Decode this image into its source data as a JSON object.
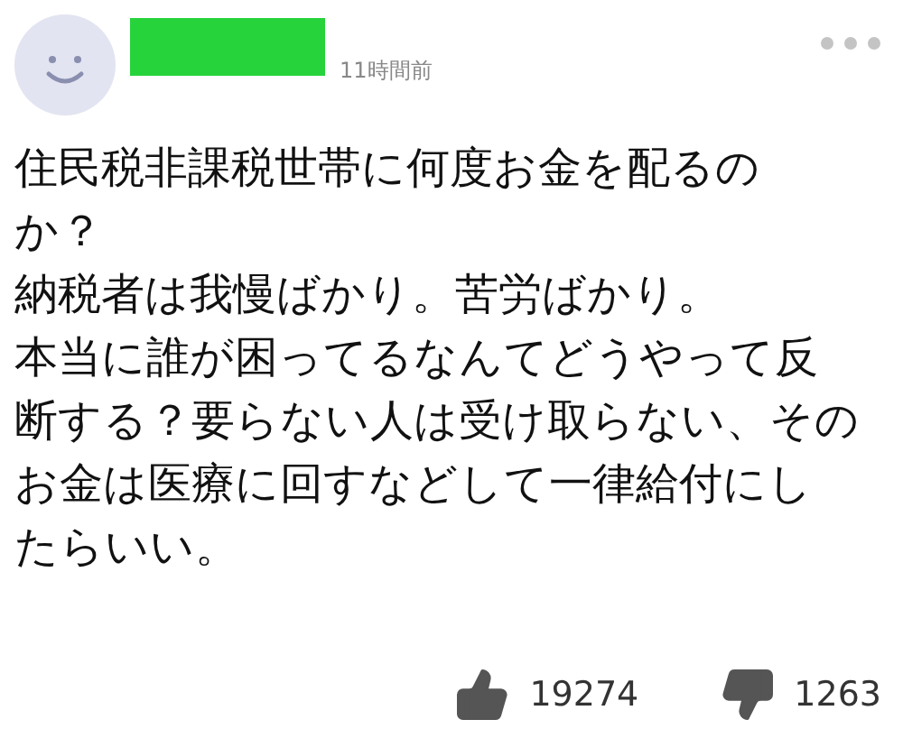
{
  "comment": {
    "time": "11時間前",
    "lines": [
      "住民税非課税世帯に何度お金を配るの",
      "か？",
      "納税者は我慢ばかり。苦労ばかり。",
      "本当に誰が困ってるなんてどうやって反",
      "断する？要らない人は受け取らない、その",
      "お金は医療に回すなどして一律給付にし",
      "たらいい。"
    ],
    "likes": "19274",
    "dislikes": "1263"
  }
}
